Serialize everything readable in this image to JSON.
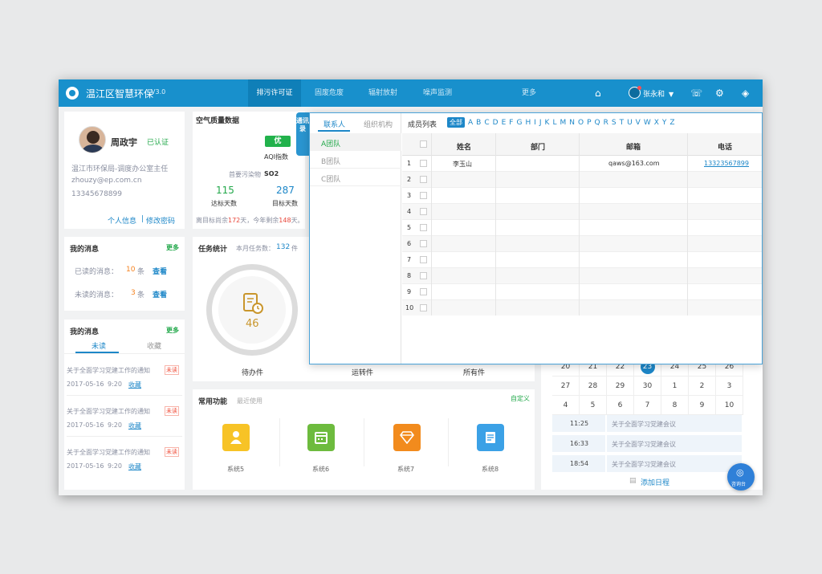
{
  "nav": {
    "title": "温江区智慧环保",
    "version": "V3.0",
    "tabs": [
      "排污许可证",
      "固废危废",
      "辐射放射",
      "噪声监测",
      "更多"
    ],
    "user": "张永和"
  },
  "profile": {
    "name": "周政宇",
    "verified": "已认证",
    "org": "温江市环保局-调度办公室主任",
    "email": "zhouzy@ep.com.cn",
    "phone": "13345678899",
    "link_info": "个人信息",
    "link_pwd": "修改密码",
    "separator": "|"
  },
  "messages": {
    "title": "我的消息",
    "more": "更多",
    "read_label": "已读的消息：",
    "read_count": "10",
    "unread_label": "未读的消息：",
    "unread_count": "3",
    "unit": "条",
    "view": "查看"
  },
  "messages2": {
    "title": "我的消息",
    "more": "更多",
    "tab_unread": "未读",
    "tab_fav": "收藏",
    "items": [
      {
        "title": "关于全面学习党建工作的通知",
        "badge": "未读",
        "date": "2017-05-16",
        "time": "9:20",
        "action": "收藏"
      },
      {
        "title": "关于全面学习党建工作的通知",
        "badge": "未读",
        "date": "2017-05-16",
        "time": "9:20",
        "action": "收藏"
      },
      {
        "title": "关于全面学习党建工作的通知",
        "badge": "未读",
        "date": "2017-05-16",
        "time": "9:20",
        "action": "收藏"
      }
    ]
  },
  "air": {
    "title": "空气质量数据",
    "grade": "优",
    "aqi_label": "AQI指数",
    "pollutant_label": "首要污染物",
    "pollutant": "SO2",
    "days_ok": "115",
    "days_ok_label": "达标天数",
    "days_target": "287",
    "days_target_label": "目标天数",
    "note_a": "离目标尚余",
    "note_b": "172",
    "note_c": "天，今年剩余",
    "note_d": "148",
    "note_e": "天。"
  },
  "tasks": {
    "title": "任务统计",
    "month_label": "本月任务数：",
    "month_count": "132",
    "month_unit": "件",
    "count": "46",
    "labels": [
      "待办件",
      "运转件",
      "所有件"
    ]
  },
  "functions": {
    "title": "常用功能",
    "sub": "最近使用",
    "custom": "自定义",
    "tiles": [
      {
        "label": "系统5",
        "color": "#f7c326"
      },
      {
        "label": "系统6",
        "color": "#6dbb3e"
      },
      {
        "label": "系统7",
        "color": "#f28b1d"
      },
      {
        "label": "系统8",
        "color": "#3ba1e6"
      }
    ]
  },
  "calendar": {
    "rows": [
      [
        "20",
        "21",
        "22",
        "23",
        "24",
        "25",
        "26"
      ],
      [
        "27",
        "28",
        "29",
        "30",
        "1",
        "2",
        "3"
      ],
      [
        "4",
        "5",
        "6",
        "7",
        "8",
        "9",
        "10"
      ]
    ],
    "today": "23",
    "schedule": [
      {
        "time": "11:25",
        "text": "关于全面学习党建会议"
      },
      {
        "time": "16:33",
        "text": "关于全面学习党建会议"
      },
      {
        "time": "18:54",
        "text": "关于全面学习党建会议"
      }
    ],
    "add": "添加日程",
    "console": "咨询台"
  },
  "contacts": {
    "side_tab": "通讯录",
    "tab_contacts": "联系人",
    "tab_org": "组织机构",
    "teams": [
      "A团队",
      "B团队",
      "C团队"
    ],
    "member_label": "成员列表",
    "all": "全部",
    "letters": [
      "A",
      "B",
      "C",
      "D",
      "E",
      "F",
      "G",
      "H",
      "I",
      "J",
      "K",
      "L",
      "M",
      "N",
      "O",
      "P",
      "Q",
      "R",
      "S",
      "T",
      "U",
      "V",
      "W",
      "X",
      "Y",
      "Z"
    ],
    "headers": [
      "姓名",
      "部门",
      "邮箱",
      "电话"
    ],
    "row1": {
      "name": "李玉山",
      "dept": "",
      "email": "qaws@163.com",
      "phone": "13323567899"
    },
    "row_numbers": [
      "1",
      "2",
      "3",
      "4",
      "5",
      "6",
      "7",
      "8",
      "9",
      "10"
    ]
  }
}
